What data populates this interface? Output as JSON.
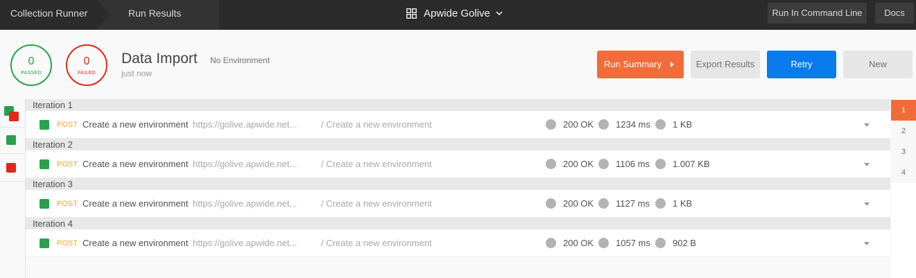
{
  "topbar": {
    "crumbs": [
      "Collection Runner",
      "Run Results"
    ],
    "workspace": "Apwide Golive",
    "buttons": {
      "command_line": "Run In Command Line",
      "docs": "Docs"
    }
  },
  "summary": {
    "passed_count": "0",
    "passed_label": "PASSED",
    "failed_count": "0",
    "failed_label": "FAILED",
    "collection_name": "Data Import",
    "environment": "No Environment",
    "time": "just now"
  },
  "actions": {
    "run_summary": "Run Summary",
    "export_results": "Export Results",
    "retry": "Retry",
    "new": "New"
  },
  "iterations": [
    {
      "label": "Iteration 1",
      "request": {
        "method": "POST",
        "name": "Create a new environment",
        "url": "https://golive.apwide.net...",
        "path": "/ Create a new environment",
        "status": "200 OK",
        "time": "1234 ms",
        "size": "1 KB"
      }
    },
    {
      "label": "Iteration 2",
      "request": {
        "method": "POST",
        "name": "Create a new environment",
        "url": "https://golive.apwide.net...",
        "path": "/ Create a new environment",
        "status": "200 OK",
        "time": "1106 ms",
        "size": "1.007 KB"
      }
    },
    {
      "label": "Iteration 3",
      "request": {
        "method": "POST",
        "name": "Create a new environment",
        "url": "https://golive.apwide.net...",
        "path": "/ Create a new environment",
        "status": "200 OK",
        "time": "1127 ms",
        "size": "1 KB"
      }
    },
    {
      "label": "Iteration 4",
      "request": {
        "method": "POST",
        "name": "Create a new environment",
        "url": "https://golive.apwide.net...",
        "path": "/ Create a new environment",
        "status": "200 OK",
        "time": "1057 ms",
        "size": "902 B"
      }
    }
  ],
  "pager": [
    "1",
    "2",
    "3",
    "4"
  ],
  "colors": {
    "pass": "#2aa04d",
    "fail": "#e4271b",
    "accent": "#f26b3a",
    "primary": "#097bed",
    "method_post": "#f5a623"
  }
}
